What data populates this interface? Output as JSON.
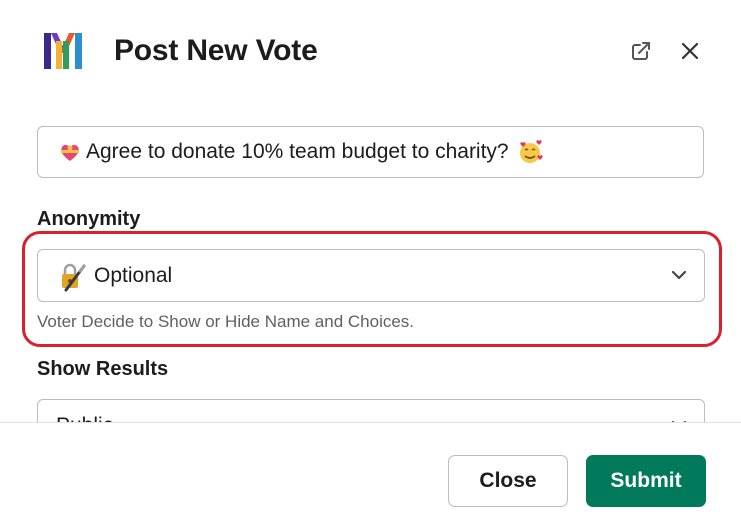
{
  "header": {
    "title": "Post New Vote",
    "logo_icon": "app-logo-icon",
    "popout_icon": "external-link-icon",
    "close_icon": "close-icon"
  },
  "vote": {
    "question": "Agree to donate 10% team budget to charity?",
    "emoji_left": "heart-with-ribbon-emoji",
    "emoji_right": "smiling-face-with-hearts-emoji"
  },
  "anonymity": {
    "label": "Anonymity",
    "selected": "Optional",
    "icon": "lock-with-pen-emoji",
    "hint": "Voter Decide to Show or Hide Name and Choices."
  },
  "show_results": {
    "label": "Show Results",
    "selected_partial": "Public"
  },
  "footer": {
    "close_label": "Close",
    "submit_label": "Submit"
  },
  "colors": {
    "submit_bg": "#007a5a",
    "highlight_border": "#d9202b",
    "text": "#1d1c1d",
    "hint_text": "#616061"
  }
}
